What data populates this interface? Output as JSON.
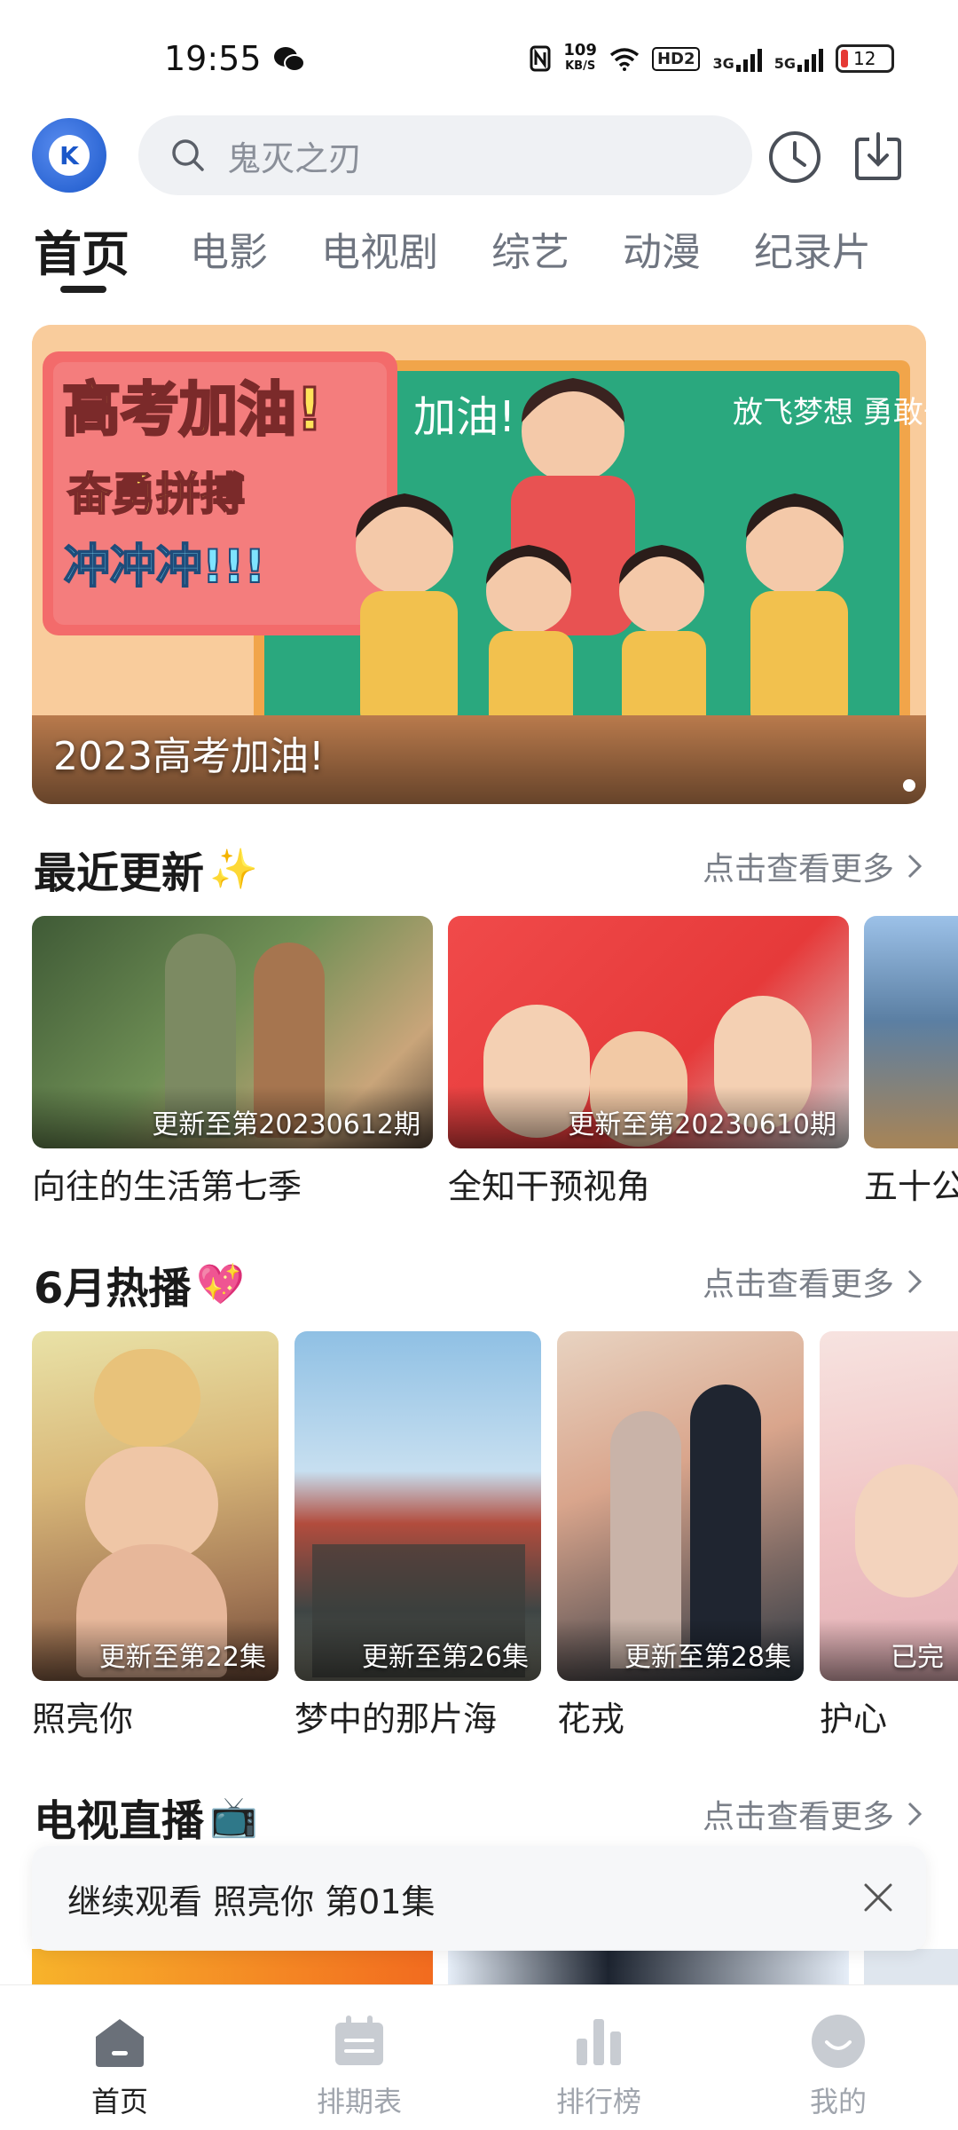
{
  "status_bar": {
    "time": "19:55",
    "net_speed_value": "109",
    "net_speed_unit": "KB/S",
    "hd_label": "HD2",
    "signal1_label": "3G",
    "signal2_label": "5G",
    "battery_level": "12"
  },
  "header": {
    "avatar_letter": "K",
    "search_placeholder": "鬼灭之刃",
    "history_icon": "clock-icon",
    "download_icon": "download-icon"
  },
  "tabs": [
    {
      "label": "首页",
      "active": true
    },
    {
      "label": "电影",
      "active": false
    },
    {
      "label": "电视剧",
      "active": false
    },
    {
      "label": "综艺",
      "active": false
    },
    {
      "label": "动漫",
      "active": false
    },
    {
      "label": "纪录片",
      "active": false
    }
  ],
  "banner": {
    "caption": "2023高考加油!",
    "art_text_1": "高考加油!",
    "art_text_2": "奋勇拼搏",
    "art_text_3": "冲冲冲!!!",
    "art_text_4": "加油!",
    "art_text_5": "放飞梦想 勇敢去拼"
  },
  "recent": {
    "title": "最近更新",
    "emoji": "✨",
    "more": "点击查看更多",
    "items": [
      {
        "title": "向往的生活第七季",
        "badge": "更新至第20230612期"
      },
      {
        "title": "全知干预视角",
        "badge": "更新至第20230610期"
      },
      {
        "title": "五十公",
        "badge": ""
      }
    ]
  },
  "june": {
    "title": "6月热播",
    "emoji": "💖",
    "more": "点击查看更多",
    "items": [
      {
        "title": "照亮你",
        "badge": "更新至第22集"
      },
      {
        "title": "梦中的那片海",
        "badge": "更新至第26集"
      },
      {
        "title": "花戎",
        "badge": "更新至第28集"
      },
      {
        "title": "护心",
        "badge": "已完"
      }
    ]
  },
  "live": {
    "title": "电视直播",
    "emoji": "📺",
    "more": "点击查看更多"
  },
  "continue_watch": {
    "text": "继续观看 照亮你 第01集"
  },
  "bottom_nav": [
    {
      "label": "首页",
      "icon": "home-icon",
      "active": true
    },
    {
      "label": "排期表",
      "icon": "schedule-icon",
      "active": false
    },
    {
      "label": "排行榜",
      "icon": "ranking-icon",
      "active": false
    },
    {
      "label": "我的",
      "icon": "profile-icon",
      "active": false
    }
  ],
  "colors": {
    "accent": "#1f1f1f",
    "inactive": "#a0a5ad",
    "search_bg": "#eff1f4"
  }
}
